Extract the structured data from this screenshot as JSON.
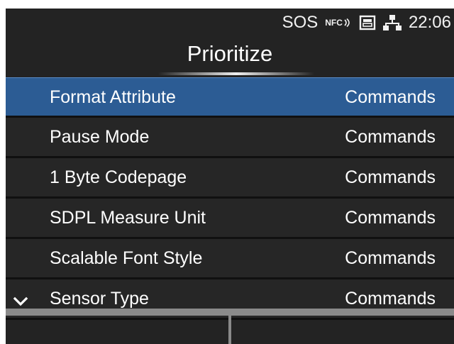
{
  "status_bar": {
    "sos_label": "SOS",
    "nfc_label": "NFC",
    "card_icon": "sd-card-icon",
    "network_icon": "network-icon",
    "time": "22:06"
  },
  "header": {
    "title": "Prioritize"
  },
  "list": {
    "items": [
      {
        "label": "Format Attribute",
        "value": "Commands",
        "selected": true
      },
      {
        "label": "Pause Mode",
        "value": "Commands"
      },
      {
        "label": "1 Byte Codepage",
        "value": "Commands"
      },
      {
        "label": "SDPL Measure Unit",
        "value": "Commands"
      },
      {
        "label": "Scalable Font Style",
        "value": "Commands"
      },
      {
        "label": "Sensor Type",
        "value": "Commands",
        "icon": "chevron-down-icon"
      }
    ]
  },
  "colors": {
    "background": "#232323",
    "selected_row": "#2c5c94",
    "text": "#ffffff"
  }
}
